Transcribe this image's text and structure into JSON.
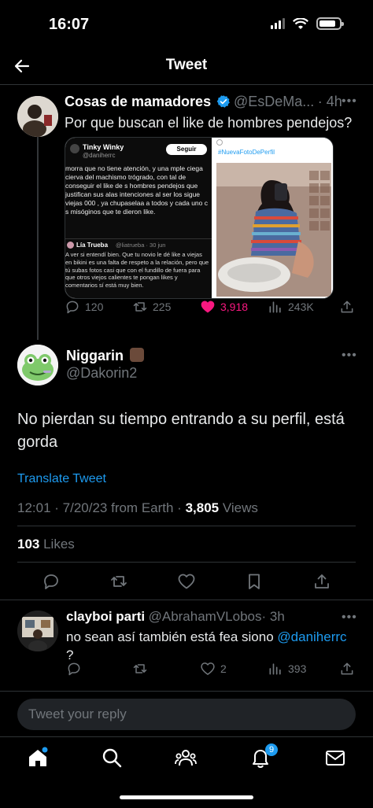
{
  "status": {
    "time": "16:07"
  },
  "header": {
    "title": "Tweet"
  },
  "parent_tweet": {
    "name": "Cosas de mamadores",
    "handle": "@EsDeMa...",
    "time": "· 4h",
    "text": "Por que buscan el like de hombres pendejos?",
    "embedded": {
      "user_name": "Tinky Winky",
      "user_handle": "@daniherrc",
      "follow_label": "Seguir",
      "text": "morra que no tiene atención, y una mple ciega cierva del machismo trógrado, con tal de conseguir el like de s hombres pendejos que justifican sus alas intenciones al ser los sigue viejas 000 , ya chupaselaa a todos y cada uno c s misóginos que te dieron like.",
      "quoted_name": "Lía Trueba",
      "quoted_handle": "@liatrueba · 30 jun",
      "quoted_text": "A ver si entendí bien. Que tu novio le dé like a viejas en bikini es una falta de respeto a la relación, pero que tú subas fotos casi que con el fundillo de fuera para que otros viejos calientes te pongan likes y comentarios sí está muy bien.",
      "hashtag": "#NuevaFotoDePerfil"
    },
    "stats": {
      "replies": "120",
      "retweets": "225",
      "likes": "3,918",
      "views": "243K"
    }
  },
  "main_tweet": {
    "name": "Niggarin",
    "handle": "@Dakorin2",
    "text": "No pierdan su tiempo entrando a su perfil, está gorda",
    "translate": "Translate Tweet",
    "meta": "12:01 · 7/20/23 from Earth · ",
    "views_count": "3,805",
    "views_label": " Views",
    "likes_count": "103",
    "likes_label": " Likes"
  },
  "reply": {
    "name": "clayboi parti",
    "handle": "@AbrahamVLobos",
    "time": "· 3h",
    "text": "no sean así también está fea siono ",
    "mention": "@daniherrc",
    "text_end": "?",
    "stats": {
      "likes": "2",
      "views": "393"
    }
  },
  "reply_input": {
    "placeholder": "Tweet your reply"
  },
  "nav": {
    "notification_badge": "9"
  },
  "colors": {
    "accent": "#1d9bf0",
    "like_pink": "#f91880",
    "background": "#000000"
  }
}
